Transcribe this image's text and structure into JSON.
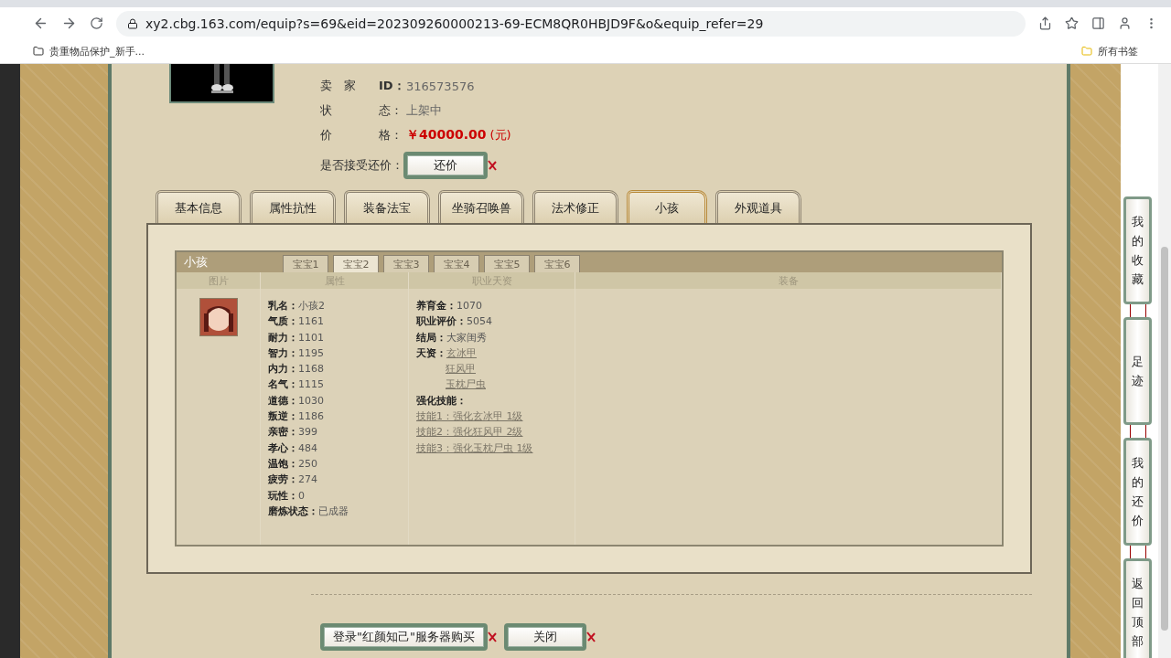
{
  "browser": {
    "url": "xy2.cbg.163.com/equip?s=69&eid=202309260000213-69-ECM8QR0HBJD9F&o&equip_refer=29",
    "bookmarks": [
      {
        "label": "贵重物品保护_新手..."
      }
    ],
    "bookmarks_folder": "所有书签"
  },
  "info_rows": [
    {
      "kind": "plain",
      "label": "卖　家",
      "field": "ID：",
      "value": "316573576"
    },
    {
      "kind": "plain",
      "label": "状",
      "field": "态：",
      "value": "上架中"
    },
    {
      "kind": "price",
      "label": "价",
      "field": "格：",
      "value": "￥40000.00",
      "unit": "(元)"
    }
  ],
  "counter_offer": {
    "label": "是否接受还价：",
    "button": "还价"
  },
  "tabs": [
    {
      "label": "基本信息",
      "selected": false
    },
    {
      "label": "属性抗性",
      "selected": false
    },
    {
      "label": "装备法宝",
      "selected": false
    },
    {
      "label": "坐骑召唤兽",
      "selected": false
    },
    {
      "label": "法术修正",
      "selected": false
    },
    {
      "label": "小孩",
      "selected": true
    },
    {
      "label": "外观道具",
      "selected": false
    }
  ],
  "child_panel": {
    "title": "小孩",
    "subtabs": [
      {
        "label": "宝宝1",
        "selected": false
      },
      {
        "label": "宝宝2",
        "selected": true
      },
      {
        "label": "宝宝3",
        "selected": false
      },
      {
        "label": "宝宝4",
        "selected": false
      },
      {
        "label": "宝宝5",
        "selected": false
      },
      {
        "label": "宝宝6",
        "selected": false
      }
    ],
    "columns": [
      "图片",
      "属性",
      "职业天资",
      "装备"
    ],
    "attributes": [
      {
        "label": "乳名：",
        "value": "小孩2"
      },
      {
        "label": "气质：",
        "value": "1161"
      },
      {
        "label": "耐力：",
        "value": "1101"
      },
      {
        "label": "智力：",
        "value": "1195"
      },
      {
        "label": "内力：",
        "value": "1168"
      },
      {
        "label": "名气：",
        "value": "1115"
      },
      {
        "label": "道德：",
        "value": "1030"
      },
      {
        "label": "叛逆：",
        "value": "1186"
      },
      {
        "label": "亲密：",
        "value": "399"
      },
      {
        "label": "孝心：",
        "value": "484"
      },
      {
        "label": "温饱：",
        "value": "250"
      },
      {
        "label": "疲劳：",
        "value": "274"
      },
      {
        "label": "玩性：",
        "value": "0"
      },
      {
        "label": "磨炼状态：",
        "value": "已成器"
      }
    ],
    "career": [
      {
        "label": "养育金：",
        "value": "1070"
      },
      {
        "label": "职业评价：",
        "value": "5054"
      },
      {
        "label": "结局：",
        "value": "大家闺秀"
      }
    ],
    "talents": {
      "label": "天资：",
      "items": [
        "玄冰甲",
        "狂风甲",
        "玉枕尸虫"
      ]
    },
    "skills": {
      "label": "强化技能：",
      "items": [
        "技能1：强化玄冰甲 1级",
        "技能2：强化狂风甲 2级",
        "技能3：强化玉枕尸虫 1级"
      ]
    }
  },
  "buttons": [
    "登录\"红颜知己\"服务器购买",
    "关闭"
  ],
  "side_buttons": [
    "我的收藏",
    "足迹",
    "我的还价",
    "返回顶部"
  ]
}
